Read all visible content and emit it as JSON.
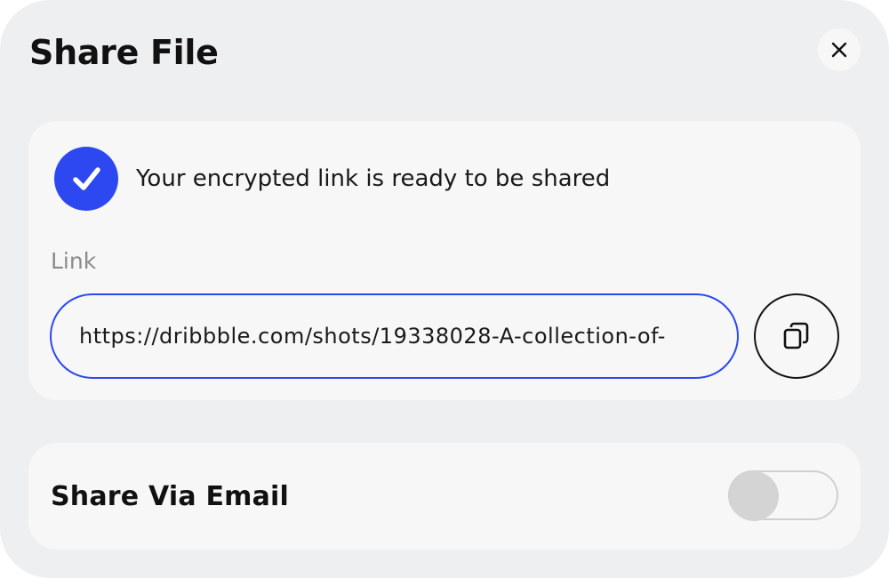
{
  "dialog": {
    "title": "Share File",
    "close_icon": "close-icon"
  },
  "link_card": {
    "status_icon": "check-circle-icon",
    "status_text": "Your encrypted link is ready to be shared",
    "link_label": "Link",
    "link_value": "https://dribbble.com/shots/19338028-A-collection-of-",
    "copy_icon": "copy-icon"
  },
  "email_card": {
    "label": "Share Via Email",
    "toggle_on": false
  },
  "colors": {
    "accent": "#2d48f1",
    "background": "#eeeff1",
    "card": "#f7f7f7",
    "toggle_off": "#d4d4d4"
  }
}
